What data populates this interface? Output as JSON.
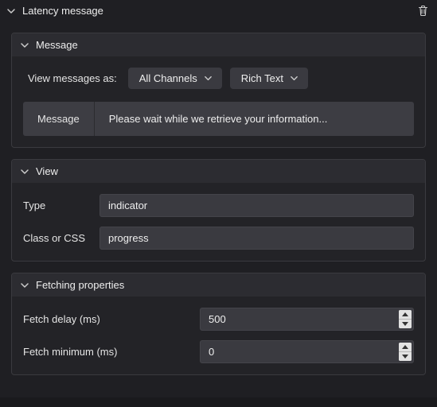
{
  "header": {
    "title": "Latency message"
  },
  "sections": {
    "message": {
      "title": "Message",
      "view_as_label": "View messages as:",
      "channels_dropdown": "All Channels",
      "format_dropdown": "Rich Text",
      "message_field_label": "Message",
      "message_value": "Please wait while we retrieve your information..."
    },
    "view": {
      "title": "View",
      "type_label": "Type",
      "type_value": "indicator",
      "class_label": "Class or CSS",
      "class_value": "progress"
    },
    "fetching": {
      "title": "Fetching properties",
      "fetch_delay_label": "Fetch delay (ms)",
      "fetch_delay_value": "500",
      "fetch_min_label": "Fetch minimum (ms)",
      "fetch_min_value": "0"
    }
  }
}
